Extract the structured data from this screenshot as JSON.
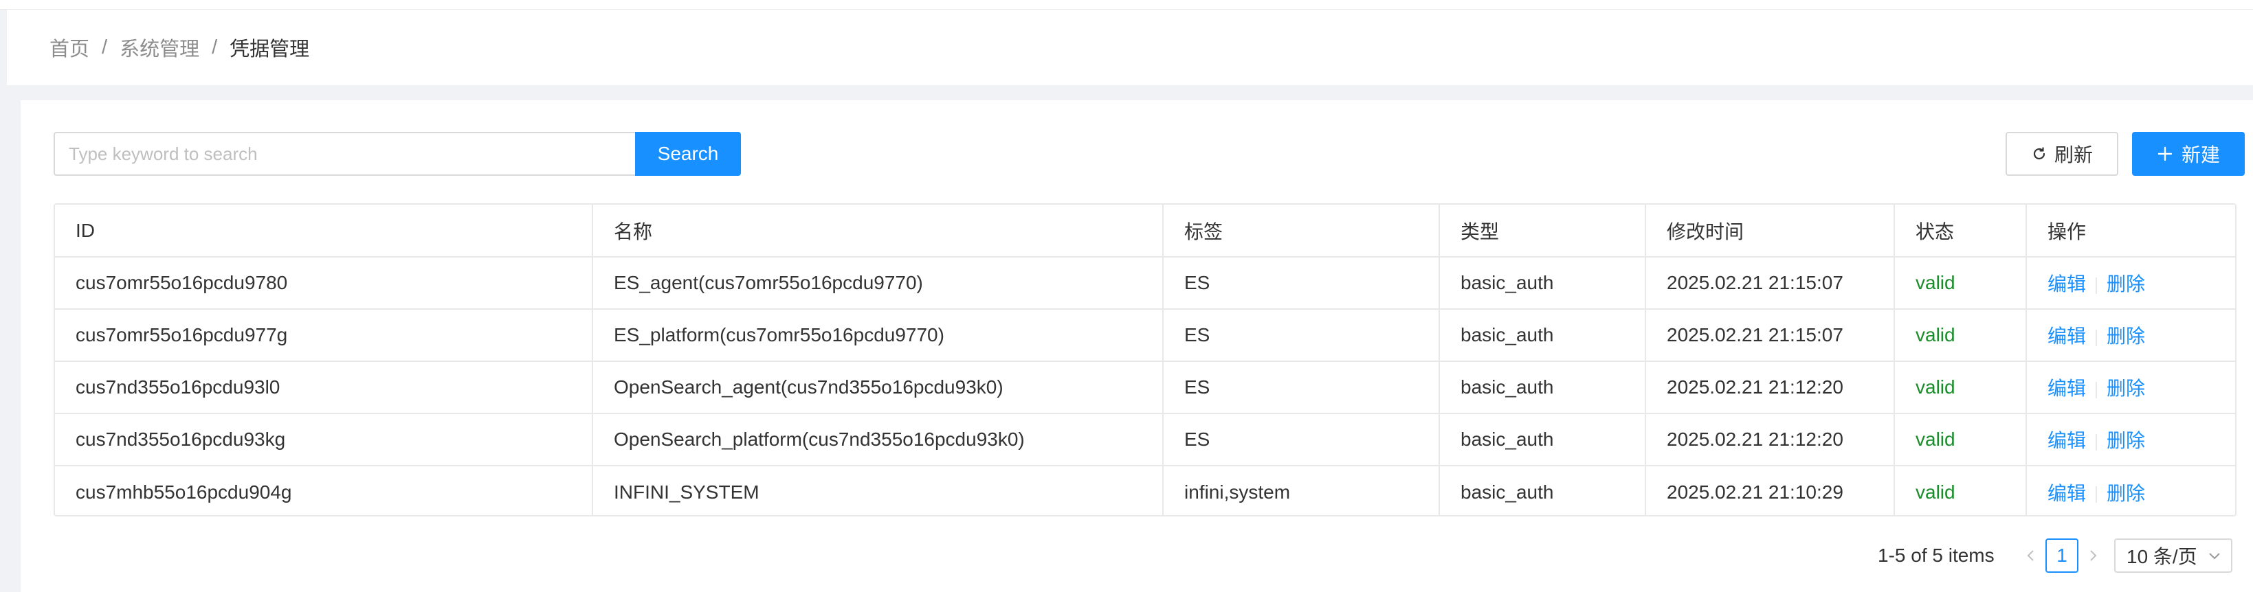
{
  "breadcrumb": {
    "items": [
      "首页",
      "系统管理",
      "凭据管理"
    ],
    "separator": "/"
  },
  "search": {
    "placeholder": "Type keyword to search",
    "value": "",
    "button_label": "Search"
  },
  "toolbar": {
    "refresh_label": "刷新",
    "refresh_icon": "reload-icon",
    "new_label": "新建",
    "new_icon": "plus-icon"
  },
  "table": {
    "columns": [
      "ID",
      "名称",
      "标签",
      "类型",
      "修改时间",
      "状态",
      "操作"
    ],
    "rows": [
      {
        "id": "cus7omr55o16pcdu9780",
        "name": "ES_agent(cus7omr55o16pcdu9770)",
        "tags": "ES",
        "type": "basic_auth",
        "modified": "2025.02.21 21:15:07",
        "status": "valid",
        "edit": "编辑",
        "delete": "删除"
      },
      {
        "id": "cus7omr55o16pcdu977g",
        "name": "ES_platform(cus7omr55o16pcdu9770)",
        "tags": "ES",
        "type": "basic_auth",
        "modified": "2025.02.21 21:15:07",
        "status": "valid",
        "edit": "编辑",
        "delete": "删除"
      },
      {
        "id": "cus7nd355o16pcdu93l0",
        "name": "OpenSearch_agent(cus7nd355o16pcdu93k0)",
        "tags": "ES",
        "type": "basic_auth",
        "modified": "2025.02.21 21:12:20",
        "status": "valid",
        "edit": "编辑",
        "delete": "删除"
      },
      {
        "id": "cus7nd355o16pcdu93kg",
        "name": "OpenSearch_platform(cus7nd355o16pcdu93k0)",
        "tags": "ES",
        "type": "basic_auth",
        "modified": "2025.02.21 21:12:20",
        "status": "valid",
        "edit": "编辑",
        "delete": "删除"
      },
      {
        "id": "cus7mhb55o16pcdu904g",
        "name": "INFINI_SYSTEM",
        "tags": "infini,system",
        "type": "basic_auth",
        "modified": "2025.02.21 21:10:29",
        "status": "valid",
        "edit": "编辑",
        "delete": "删除"
      }
    ]
  },
  "pagination": {
    "total_text": "1-5 of 5 items",
    "current_page": "1",
    "page_size": "10 条/页"
  },
  "colors": {
    "primary": "#1890ff",
    "status_valid": "#1a8d2b",
    "border": "#e8e8e8",
    "background": "#f0f2f5"
  }
}
